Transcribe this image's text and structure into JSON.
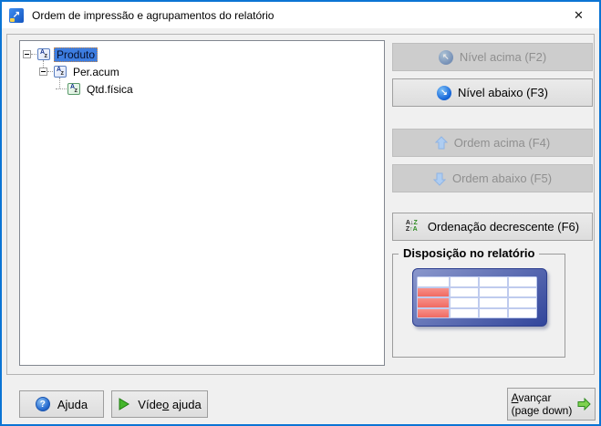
{
  "window": {
    "title": "Ordem de impressão e agrupamentos do relatório"
  },
  "glyphs": {
    "close": "✕",
    "app_arrow": "↗",
    "circle_arrow_up_left": "↖",
    "circle_arrow_down_right": "↘",
    "help_question": "?",
    "az_a": "A",
    "az_z": "z",
    "sort_l1_dark": "A↓",
    "sort_l1_green": "Z",
    "sort_l2_dark": "Z",
    "sort_l2_green": "↑A"
  },
  "tree": {
    "items": [
      {
        "label": "Produto",
        "level": 0,
        "selected": true,
        "icon": "sort-az-blue-icon"
      },
      {
        "label": "Per.acum",
        "level": 1,
        "selected": false,
        "icon": "sort-az-blue-icon"
      },
      {
        "label": "Qtd.física",
        "level": 2,
        "selected": false,
        "icon": "sort-az-green-icon"
      }
    ]
  },
  "actions": [
    {
      "label": "Nível acima (F2)",
      "icon": "circle-arrow-up-left-icon",
      "enabled": false
    },
    {
      "label": "Nível abaixo (F3)",
      "icon": "circle-arrow-down-right-icon",
      "enabled": true
    },
    {
      "label": "Ordem acima (F4)",
      "icon": "arrow-up-icon",
      "enabled": false
    },
    {
      "label": "Ordem abaixo (F5)",
      "icon": "arrow-down-icon",
      "enabled": false
    },
    {
      "label": "Ordenação decrescente (F6)",
      "icon": "sort-descending-icon",
      "enabled": true
    }
  ],
  "group": {
    "title": "Disposição no relatório"
  },
  "footer": {
    "help": {
      "pre": "A",
      "mn": "j",
      "post": "uda"
    },
    "video": {
      "pre": "Víde",
      "mn": "o",
      "post": " ajuda"
    },
    "next": {
      "mn": "A",
      "line1rest": "vançar",
      "line2": "(page down)"
    }
  },
  "colors": {
    "accent_border": "#0b74d4",
    "selection_blue": "#3d7de0",
    "disabled_button_bg": "#cdcdcd",
    "enabled_button_bg": "#e4e4e4",
    "red_cell": "#f06a62",
    "table_blue": "#31459b",
    "green_icon": "#44b62b"
  }
}
